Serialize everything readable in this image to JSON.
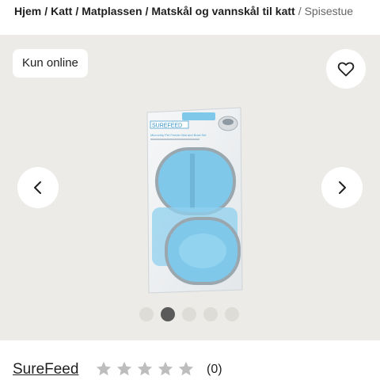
{
  "breadcrumb": {
    "items": [
      "Hjem",
      "Katt",
      "Matplassen",
      "Matskål og vannskål til katt"
    ],
    "separator": "/",
    "current": "Spisestue"
  },
  "gallery": {
    "badge": "Kun online",
    "favorite_icon": "heart-icon",
    "prev_icon": "chevron-left-icon",
    "next_icon": "chevron-right-icon",
    "dots_count": 5,
    "active_dot": 2,
    "product": {
      "brand_logo_text": "SUREFEED",
      "subtitle": "Microchip Pet Feeder Mat and Bowl Set"
    }
  },
  "info": {
    "brand": "SureFeed",
    "rating": 0,
    "rating_max": 5,
    "review_count": "(0)"
  },
  "colors": {
    "gallery_bg": "#ecebe7",
    "bowl_blue": "#7fc8ea",
    "dot_active": "#5a5a5a",
    "dot_inactive": "#dddcd7",
    "star": "#bdbdbd"
  }
}
